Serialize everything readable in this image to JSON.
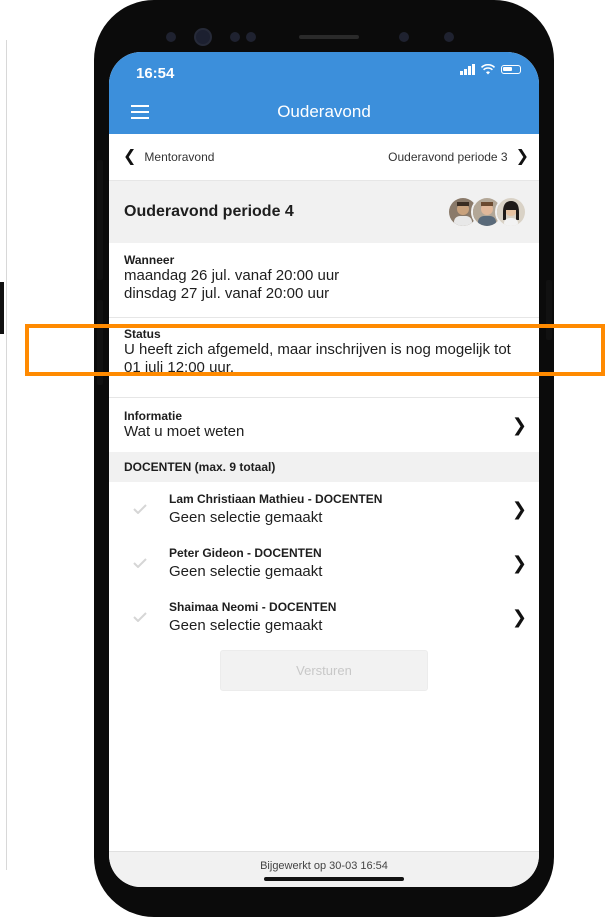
{
  "status_bar": {
    "time": "16:54"
  },
  "app_bar": {
    "title": "Ouderavond"
  },
  "nav": {
    "prev_label": "Mentoravond",
    "next_label": "Ouderavond periode 3"
  },
  "event": {
    "title": "Ouderavond periode 4"
  },
  "wanneer": {
    "label": "Wanneer",
    "lines": [
      "maandag 26 jul. vanaf 20:00 uur",
      "dinsdag 27 jul. vanaf 20:00 uur"
    ]
  },
  "status": {
    "label": "Status",
    "text": "U heeft zich afgemeld, maar inschrijven is nog mogelijk tot 01 juli 12:00 uur."
  },
  "informatie": {
    "label": "Informatie",
    "value": "Wat u moet weten"
  },
  "teachers_header": "DOCENTEN (max. 9 totaal)",
  "teachers": [
    {
      "name": "Lam Christiaan Mathieu - DOCENTEN",
      "selection": "Geen selectie gemaakt"
    },
    {
      "name": "Peter Gideon  - DOCENTEN",
      "selection": "Geen selectie gemaakt"
    },
    {
      "name": "Shaimaa Neomi - DOCENTEN",
      "selection": "Geen selectie gemaakt"
    }
  ],
  "submit_label": "Versturen",
  "footer": "Bijgewerkt op 30-03 16:54",
  "colors": {
    "app_bar": "#3c8fdb",
    "highlight": "#ff8a00",
    "section_bg": "#f1f1f1"
  },
  "icons": [
    "menu-icon",
    "chevron-left-icon",
    "chevron-right-icon",
    "check-icon",
    "signal-icon",
    "wifi-icon",
    "battery-icon"
  ]
}
